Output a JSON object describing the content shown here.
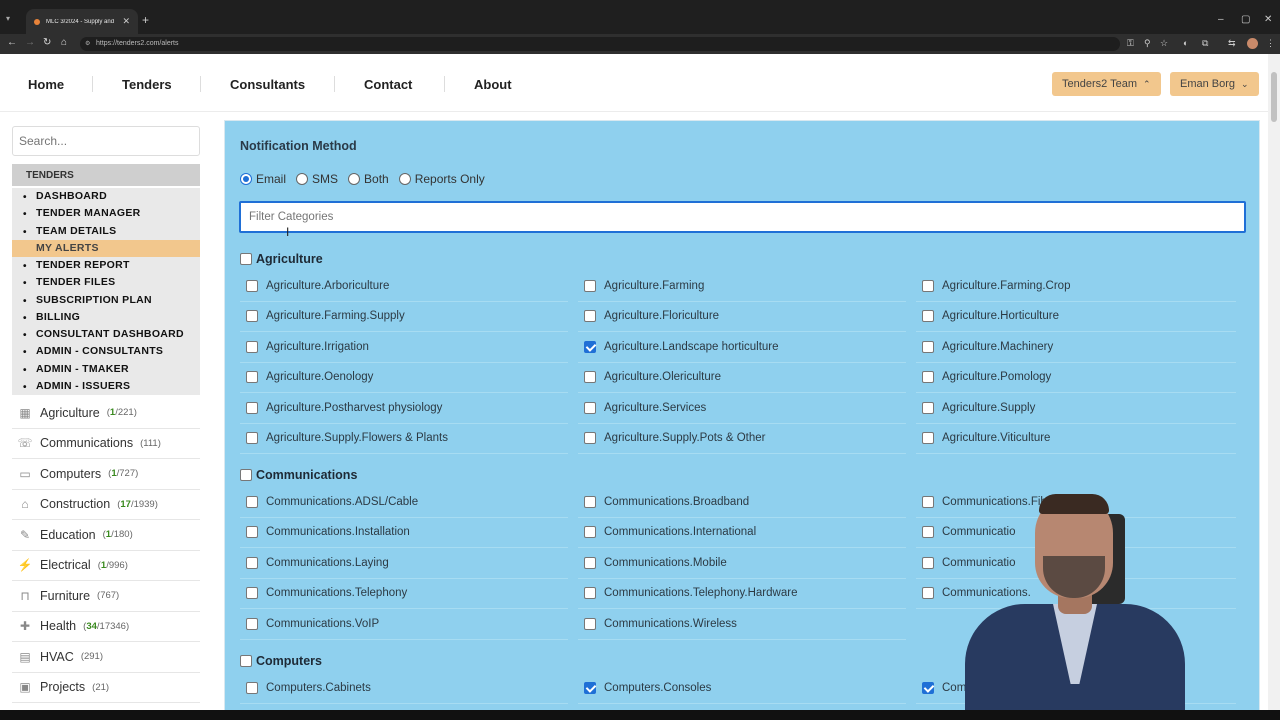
{
  "browser": {
    "tab_title": "MLC 3/2024 - Supply and insta",
    "url": "https://tenders2.com/alerts"
  },
  "nav": {
    "links": [
      "Home",
      "Tenders",
      "Consultants",
      "Contact",
      "About"
    ],
    "team_button": "Tenders2 Team",
    "user_button": "Eman Borg"
  },
  "sidebar": {
    "search_placeholder": "Search...",
    "section_header": "TENDERS",
    "menu": [
      "DASHBOARD",
      "TENDER MANAGER",
      "TEAM DETAILS",
      "MY ALERTS",
      "TENDER REPORT",
      "TENDER FILES",
      "SUBSCRIPTION PLAN",
      "BILLING",
      "CONSULTANT DASHBOARD",
      "ADMIN - CONSULTANTS",
      "ADMIN - TMAKER",
      "ADMIN - ISSUERS"
    ],
    "active_menu": "MY ALERTS",
    "categories": [
      {
        "name": "Agriculture",
        "highlight": "1",
        "total": "/221",
        "icon": "grid-icon"
      },
      {
        "name": "Communications",
        "highlight": "",
        "total": "(111)",
        "icon": "comms-icon"
      },
      {
        "name": "Computers",
        "highlight": "1",
        "total": "/727",
        "icon": "computer-icon"
      },
      {
        "name": "Construction",
        "highlight": "17",
        "total": "/1939",
        "icon": "construction-icon"
      },
      {
        "name": "Education",
        "highlight": "1",
        "total": "/180",
        "icon": "education-icon"
      },
      {
        "name": "Electrical",
        "highlight": "1",
        "total": "/996",
        "icon": "electrical-icon"
      },
      {
        "name": "Furniture",
        "highlight": "",
        "total": "(767)",
        "icon": "furniture-icon"
      },
      {
        "name": "Health",
        "highlight": "34",
        "total": "/17346",
        "icon": "health-icon"
      },
      {
        "name": "HVAC",
        "highlight": "",
        "total": "(291)",
        "icon": "hvac-icon"
      },
      {
        "name": "Projects",
        "highlight": "",
        "total": "(21)",
        "icon": "projects-icon"
      }
    ]
  },
  "main": {
    "title": "Notification Method",
    "methods": [
      {
        "label": "Email",
        "selected": true
      },
      {
        "label": "SMS",
        "selected": false
      },
      {
        "label": "Both",
        "selected": false
      },
      {
        "label": "Reports Only",
        "selected": false
      }
    ],
    "filter_placeholder": "Filter Categories",
    "groups": [
      {
        "name": "Agriculture",
        "options": [
          {
            "label": "Agriculture.Arboriculture",
            "checked": false
          },
          {
            "label": "Agriculture.Farming",
            "checked": false
          },
          {
            "label": "Agriculture.Farming.Crop",
            "checked": false
          },
          {
            "label": "Agriculture.Farming.Supply",
            "checked": false
          },
          {
            "label": "Agriculture.Floriculture",
            "checked": false
          },
          {
            "label": "Agriculture.Horticulture",
            "checked": false
          },
          {
            "label": "Agriculture.Irrigation",
            "checked": false
          },
          {
            "label": "Agriculture.Landscape horticulture",
            "checked": true
          },
          {
            "label": "Agriculture.Machinery",
            "checked": false
          },
          {
            "label": "Agriculture.Oenology",
            "checked": false
          },
          {
            "label": "Agriculture.Olericulture",
            "checked": false
          },
          {
            "label": "Agriculture.Pomology",
            "checked": false
          },
          {
            "label": "Agriculture.Postharvest physiology",
            "checked": false
          },
          {
            "label": "Agriculture.Services",
            "checked": false
          },
          {
            "label": "Agriculture.Supply",
            "checked": false
          },
          {
            "label": "Agriculture.Supply.Flowers & Plants",
            "checked": false
          },
          {
            "label": "Agriculture.Supply.Pots & Other",
            "checked": false
          },
          {
            "label": "Agriculture.Viticulture",
            "checked": false
          }
        ]
      },
      {
        "name": "Communications",
        "options": [
          {
            "label": "Communications.ADSL/Cable",
            "checked": false
          },
          {
            "label": "Communications.Broadband",
            "checked": false
          },
          {
            "label": "Communications.Fibre",
            "checked": false
          },
          {
            "label": "Communications.Installation",
            "checked": false
          },
          {
            "label": "Communications.International",
            "checked": false
          },
          {
            "label": "Communicatio",
            "checked": false
          },
          {
            "label": "Communications.Laying",
            "checked": false
          },
          {
            "label": "Communications.Mobile",
            "checked": false
          },
          {
            "label": "Communicatio",
            "checked": false
          },
          {
            "label": "Communications.Telephony",
            "checked": false
          },
          {
            "label": "Communications.Telephony.Hardware",
            "checked": false
          },
          {
            "label": "Communications.",
            "checked": false
          },
          {
            "label": "Communications.VoIP",
            "checked": false
          },
          {
            "label": "Communications.Wireless",
            "checked": false
          }
        ]
      },
      {
        "name": "Computers",
        "options": [
          {
            "label": "Computers.Cabinets",
            "checked": false
          },
          {
            "label": "Computers.Consoles",
            "checked": true
          },
          {
            "label": "Com",
            "checked": true
          }
        ]
      }
    ]
  },
  "colors": {
    "panel": "#8fd0ee",
    "accent_orange": "#f2c78d",
    "check_blue": "#1f6fd6",
    "count_green": "#3a8a1f"
  }
}
